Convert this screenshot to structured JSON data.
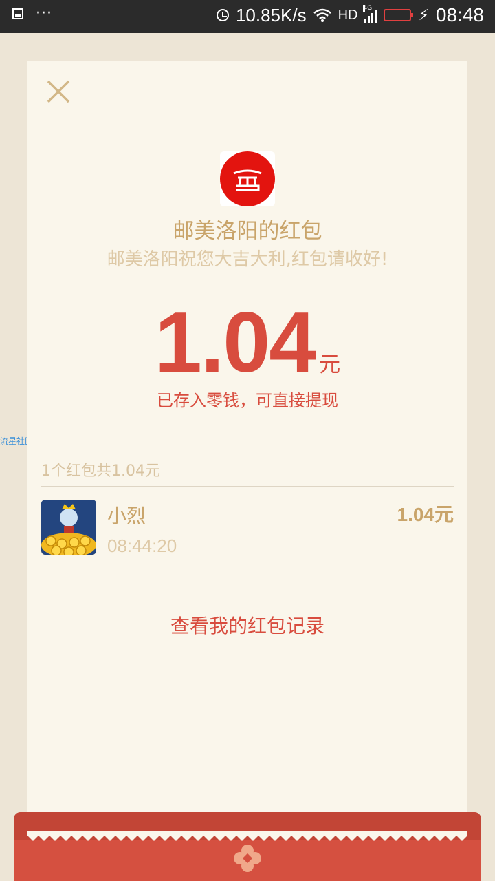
{
  "status_bar": {
    "net_speed": "10.85K/s",
    "hd_label": "HD",
    "network_label": "4G",
    "time": "08:48",
    "battery_color": "#e04040"
  },
  "header": {
    "close_icon": "close-icon",
    "sender_title": "邮美洛阳的红包",
    "blessing": "邮美洛阳祝您大吉大利,红包请收好!"
  },
  "amount": {
    "value": "1.04",
    "unit": "元",
    "note": "已存入零钱，可直接提现"
  },
  "watermark": "流星社区",
  "summary": "1个红包共1.04元",
  "receivers": [
    {
      "name": "小烈",
      "time": "08:44:20",
      "amount": "1.04元"
    }
  ],
  "records_link": "查看我的红包记录",
  "colors": {
    "accent_red": "#d84c3e",
    "gold": "#c9a46a",
    "card_bg": "#faf6eb",
    "page_bg": "#ede5d6"
  }
}
